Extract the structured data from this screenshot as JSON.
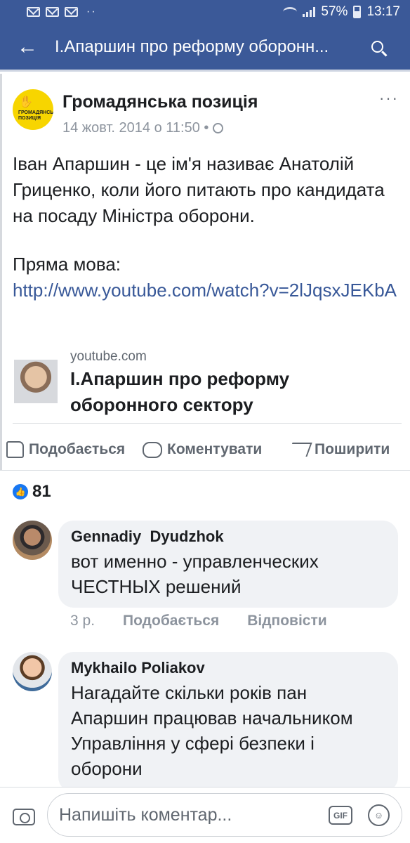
{
  "status_bar": {
    "battery": "57%",
    "time": "13:17",
    "icons": [
      "mail-icon",
      "mail-icon",
      "mail-icon",
      "more-dots-icon",
      "wifi-icon",
      "signal-icon",
      "battery-icon"
    ]
  },
  "app_bar": {
    "title": "І.Апаршин про реформу оборонн...",
    "back_icon": "arrow-left-icon",
    "search_icon": "search-icon"
  },
  "post": {
    "page_name": "Громадянська позиція",
    "logo_text": "ГРОМАДЯНСЬКА ПОЗИЦІЯ",
    "timestamp": "14 жовт. 2014 о 11:50 •",
    "text_1": "Іван Апаршин - це ім'я називає Анатолій Гриценко, коли його питають про кандидата на посаду Міністра оборони.",
    "text_2": "Пряма мова:",
    "link": "http://www.youtube.com/watch?v=2lJqsxJEKbA",
    "share": {
      "domain": "youtube.com",
      "title": "І.Апаршин про реформу оборонного сектору"
    },
    "actions": {
      "like": "Подобається",
      "comment": "Коментувати",
      "share": "Поширити"
    }
  },
  "reactions": {
    "count": "81"
  },
  "comments": [
    {
      "author": "Gennadiy  Dyudzhok",
      "text": "вот именно - управленческих ЧЕСТНЫХ решений",
      "time": "3 р.",
      "like": "Подобається",
      "reply": "Відповісти"
    },
    {
      "author": "Mykhailo Poliakov",
      "text": "Нагадайте скільки років пан Апаршин працював начальником Управління у сфері безпеки і оборони"
    }
  ],
  "composer": {
    "placeholder": "Напишіть коментар...",
    "gif": "GIF",
    "emoji": "☺"
  }
}
